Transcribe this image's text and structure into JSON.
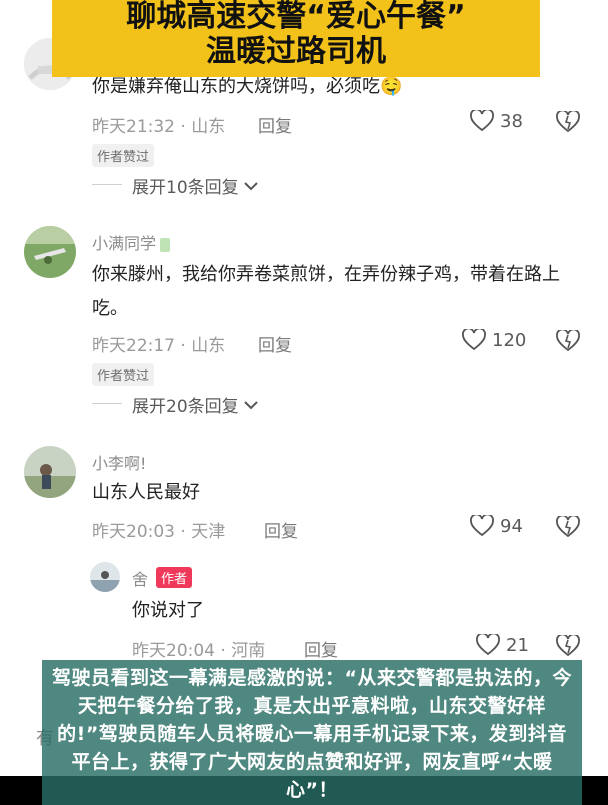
{
  "banner": {
    "line1": "聊城高速交警“爱心午餐”",
    "line2": "温暖过路司机"
  },
  "comments": [
    {
      "text": "你是嫌弃俺山东的大烧饼吗，必须吃",
      "emoji": "🤤",
      "time": "昨天21:32 · 山东",
      "reply": "回复",
      "likes": "38",
      "author_liked": "作者赞过",
      "expand": "展开10条回复"
    },
    {
      "username": "小满同学",
      "text": "你来滕州，我给你弄卷菜煎饼，在弄份辣子鸡，带着在路上吃。",
      "time": "昨天22:17 · 山东",
      "reply": "回复",
      "likes": "120",
      "author_liked": "作者赞过",
      "expand": "展开20条回复"
    },
    {
      "username": "小李啊!",
      "text": "山东人民最好",
      "time": "昨天20:03 · 天津",
      "reply": "回复",
      "likes": "94"
    }
  ],
  "sub_reply": {
    "username": "舍",
    "author_tag": "作者",
    "text": "你说对了",
    "time": "昨天20:04 · 河南",
    "reply": "回复",
    "likes": "21"
  },
  "input": {
    "hint": "有"
  },
  "caption": {
    "text": "驾驶员看到这一幕满是感激的说：“从来交警都是执法的，今天把午餐分给了我，真是太出乎意料啦，山东交警好样的!”驾驶员随车人员将暖心一幕用手机记录下来，发到抖音平台上，获得了广大网友的点赞和好评，网友直呼“太暖心”！"
  },
  "colors": {
    "banner_bg": "#f3c21a",
    "caption_bg": "#286e64",
    "author_tag_bg": "#f0385a"
  }
}
